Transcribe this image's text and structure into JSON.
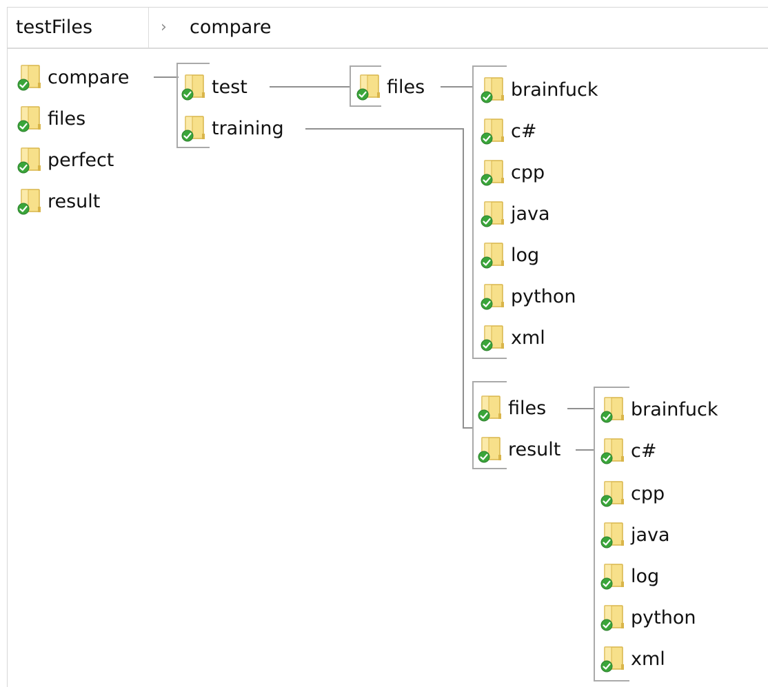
{
  "breadcrumb": {
    "root_label": "testFiles",
    "separator": "›",
    "current": "compare"
  },
  "col1": [
    {
      "label": "compare"
    },
    {
      "label": "files"
    },
    {
      "label": "perfect"
    },
    {
      "label": "result"
    }
  ],
  "col2": [
    {
      "label": "test"
    },
    {
      "label": "training"
    }
  ],
  "col3_test": [
    {
      "label": "files"
    }
  ],
  "col4_test_files": [
    {
      "label": "brainfuck"
    },
    {
      "label": "c#"
    },
    {
      "label": "cpp"
    },
    {
      "label": "java"
    },
    {
      "label": "log"
    },
    {
      "label": "python"
    },
    {
      "label": "xml"
    }
  ],
  "col3_training": [
    {
      "label": "files"
    },
    {
      "label": "result"
    }
  ],
  "col4_training_files": [
    {
      "label": "brainfuck"
    },
    {
      "label": "c#"
    },
    {
      "label": "cpp"
    },
    {
      "label": "java"
    },
    {
      "label": "log"
    },
    {
      "label": "python"
    },
    {
      "label": "xml"
    }
  ],
  "icons": {
    "folder": "folder-icon",
    "check": "check-icon"
  },
  "colors": {
    "folder_fill": "#f7e08a",
    "folder_edge": "#d9b54a",
    "check_green": "#3aa53a"
  }
}
